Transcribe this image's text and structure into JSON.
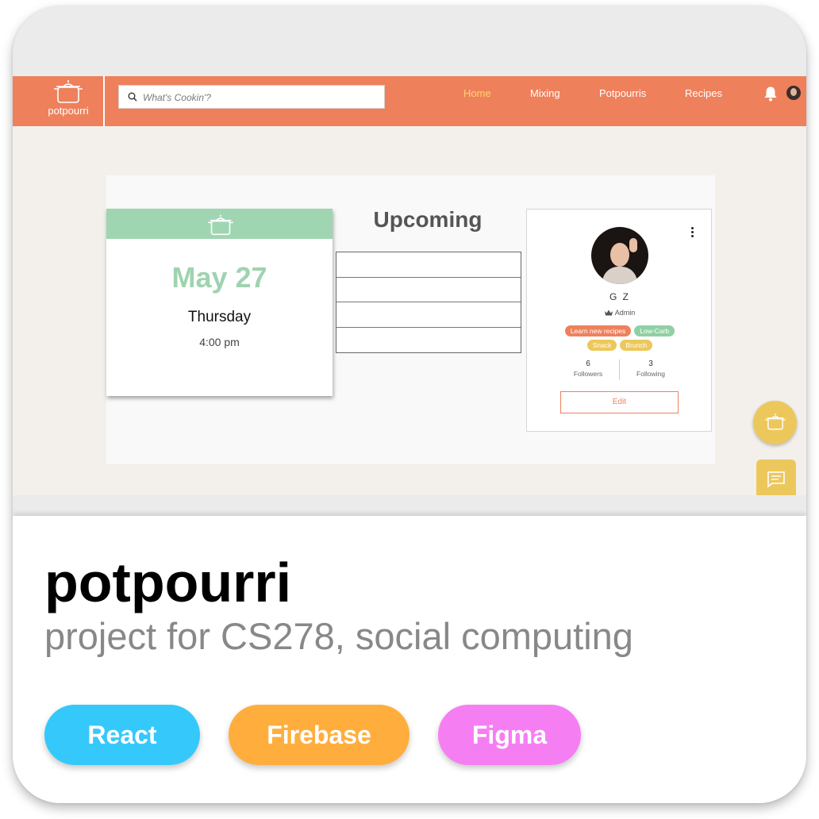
{
  "app": {
    "logo_text": "potpourri",
    "search": {
      "placeholder": "What's Cookin'?"
    },
    "nav": [
      {
        "label": "Home",
        "active": true
      },
      {
        "label": "Mixing",
        "active": false
      },
      {
        "label": "Potpourris",
        "active": false
      },
      {
        "label": "Recipes",
        "active": false
      }
    ],
    "icons": {
      "bell": "bell-icon",
      "avatar": "user-avatar",
      "pot": "pot-icon",
      "chat": "chat-icon",
      "search": "search-icon"
    }
  },
  "date_card": {
    "date": "May 27",
    "day": "Thursday",
    "time": "4:00 pm"
  },
  "upcoming": {
    "title": "Upcoming"
  },
  "profile": {
    "name": "G Z",
    "role": "Admin",
    "tags": [
      {
        "label": "Learn new recipes",
        "color": "#ef805c"
      },
      {
        "label": "Low-Carb",
        "color": "#8fd0a5"
      },
      {
        "label": "Snack",
        "color": "#ecc85c"
      },
      {
        "label": "Brunch",
        "color": "#ecc85c"
      }
    ],
    "followers_count": "6",
    "followers_label": "Followers",
    "following_count": "3",
    "following_label": "Following",
    "edit_label": "Edit"
  },
  "project": {
    "title": "potpourri",
    "subtitle": "project for CS278, social computing",
    "tech": [
      {
        "label": "React",
        "color": "#35c9fb"
      },
      {
        "label": "Firebase",
        "color": "#ffae3d"
      },
      {
        "label": "Figma",
        "color": "#f67ef3"
      }
    ]
  },
  "colors": {
    "navbar": "#ef805c",
    "nav_active": "#f7d86a",
    "mint": "#a0d5b1",
    "gold": "#ecc85c"
  }
}
